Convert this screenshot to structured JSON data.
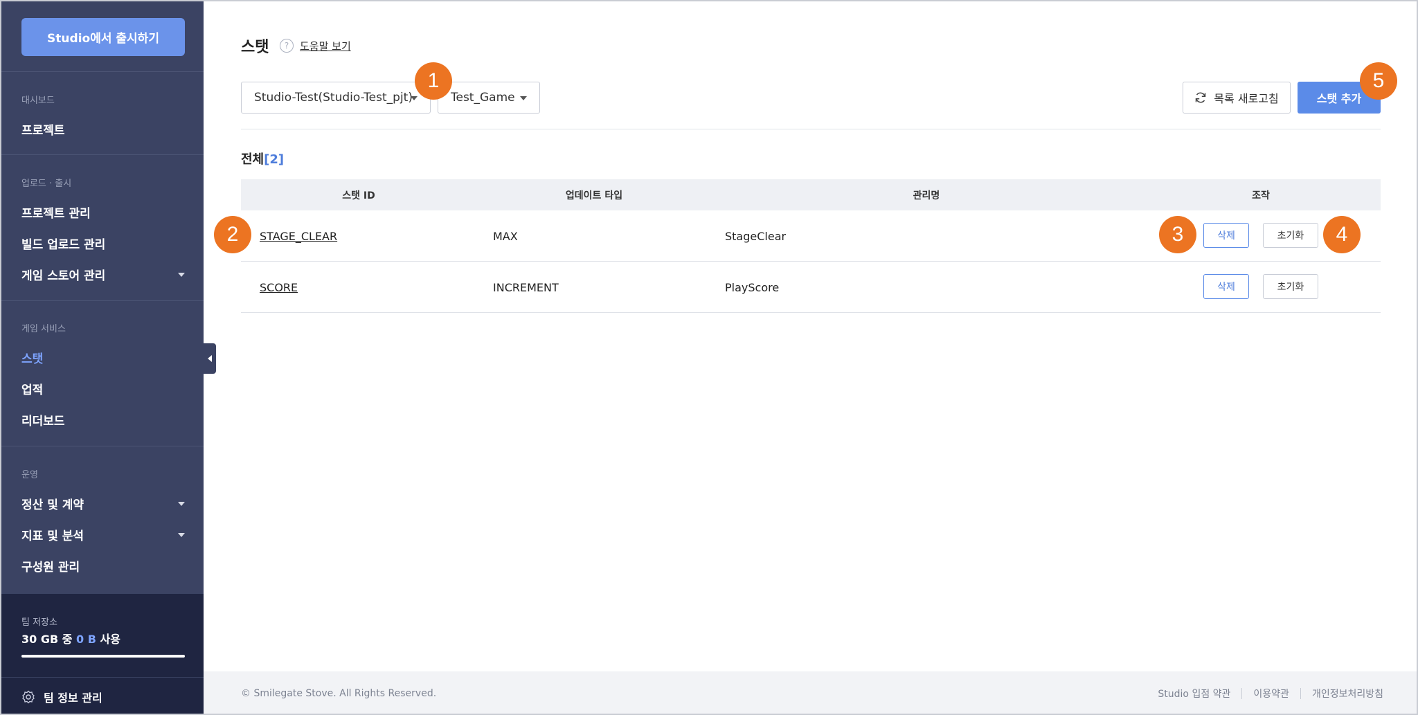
{
  "sidebar": {
    "publish_button": "Studio에서 출시하기",
    "sections": [
      {
        "label": "대시보드",
        "items": [
          {
            "label": "프로젝트"
          }
        ]
      },
      {
        "label": "업로드 · 출시",
        "items": [
          {
            "label": "프로젝트 관리"
          },
          {
            "label": "빌드 업로드 관리"
          },
          {
            "label": "게임 스토어 관리"
          }
        ]
      },
      {
        "label": "게임 서비스",
        "items": [
          {
            "label": "스탯"
          },
          {
            "label": "업적"
          },
          {
            "label": "리더보드"
          }
        ]
      },
      {
        "label": "운영",
        "items": [
          {
            "label": "정산 및 계약"
          },
          {
            "label": "지표 및 분석"
          },
          {
            "label": "구성원 관리"
          }
        ]
      }
    ],
    "storage": {
      "label": "팀 저장소",
      "total": "30 GB 중",
      "used": "0 B",
      "suffix": "사용",
      "usage_fraction": 0
    },
    "team_info": "팀 정보 관리"
  },
  "main": {
    "title": "스탯",
    "help_link": "도움말 보기",
    "project_select": "Studio-Test(Studio-Test_pjt)",
    "game_select": "Test_Game",
    "refresh_button": "목록 새로고침",
    "add_button": "스탯 추가",
    "total_label": "전체",
    "total_open": "[",
    "total_count": "2",
    "total_close": "]",
    "columns": [
      "스탯 ID",
      "업데이트 타입",
      "관리명",
      "조작"
    ],
    "rows": [
      {
        "id": "STAGE_CLEAR",
        "type": "MAX",
        "name": "StageClear",
        "delete": "삭제",
        "reset": "초기화"
      },
      {
        "id": "SCORE",
        "type": "INCREMENT",
        "name": "PlayScore",
        "delete": "삭제",
        "reset": "초기화"
      }
    ]
  },
  "badges": [
    "1",
    "2",
    "3",
    "4",
    "5"
  ],
  "footer": {
    "copyright": "© Smilegate Stove. All Rights Reserved.",
    "links": [
      "Studio 입점 약관",
      "이용약관",
      "개인정보처리방침"
    ]
  },
  "colors": {
    "sidebar_bg": "#3b4363",
    "accent": "#5b8be8",
    "badge": "#ec7422",
    "active_nav": "#7ea4ff"
  }
}
